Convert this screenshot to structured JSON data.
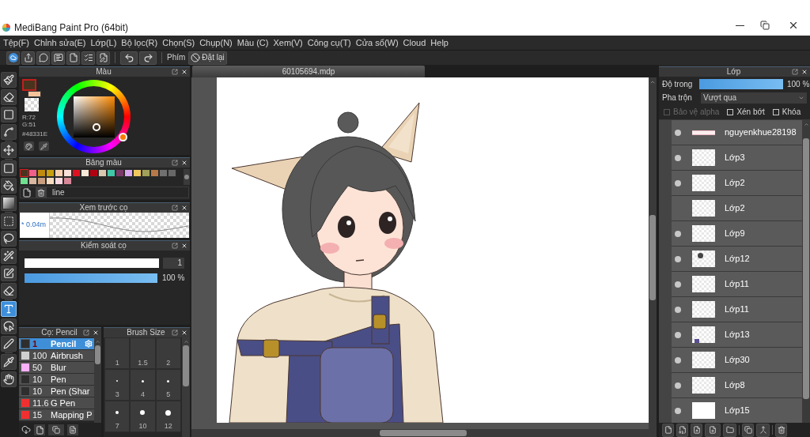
{
  "window": {
    "title": "MediBang Paint Pro (64bit)"
  },
  "menu": [
    "Tệp(F)",
    "Chỉnh sửa(E)",
    "Lớp(L)",
    "Bộ lọc(R)",
    "Chọn(S)",
    "Chụp(N)",
    "Màu (C)",
    "Xem(V)",
    "Công cụ(T)",
    "Cửa sổ(W)",
    "Cloud",
    "Help"
  ],
  "toolbar": {
    "shortcut_label": "Phím",
    "reset_button": "Đặt lại"
  },
  "tools": [
    [
      {
        "kind": "brush",
        "selected": false
      },
      {
        "kind": "eraser",
        "selected": false
      },
      {
        "kind": "shape",
        "selected": false
      },
      {
        "kind": "curve",
        "selected": false
      }
    ],
    [
      {
        "kind": "move",
        "selected": false
      }
    ],
    [
      {
        "kind": "fill",
        "selected": false
      },
      {
        "kind": "bucket",
        "selected": false
      },
      {
        "kind": "gradient",
        "selected": false
      }
    ],
    [
      {
        "kind": "select",
        "selected": false
      },
      {
        "kind": "lasso",
        "selected": false
      },
      {
        "kind": "wand",
        "selected": false
      },
      {
        "kind": "selpen",
        "selected": false
      },
      {
        "kind": "seleraser",
        "selected": false
      }
    ],
    [
      {
        "kind": "text",
        "selected": true
      },
      {
        "kind": "operation",
        "selected": false
      },
      {
        "kind": "pen",
        "selected": false
      }
    ],
    [
      {
        "kind": "dropper",
        "selected": false
      },
      {
        "kind": "hand",
        "selected": false
      }
    ]
  ],
  "color_panel": {
    "title": "Màu",
    "current_colors": [
      {
        "color": "#48331e",
        "selected": true
      },
      {
        "color": "#f7c39a",
        "selected": false
      }
    ],
    "readouts": [
      "R:72",
      "G:51",
      "#48331E"
    ]
  },
  "palette_panel": {
    "title": "Bảng màu",
    "swatches": [
      {
        "color": "#4a3320",
        "selected": true
      },
      {
        "color": "#f0608a",
        "selected": false
      },
      {
        "color": "#c08c10",
        "selected": false
      },
      {
        "color": "#c8a010",
        "selected": false
      },
      {
        "color": "#f8d0b0",
        "selected": false
      },
      {
        "color": "#f8e0d8",
        "selected": false
      },
      {
        "color": "#e01020",
        "selected": false
      },
      {
        "color": "#fae8d8",
        "selected": false
      },
      {
        "color": "#b00010",
        "selected": false
      },
      {
        "color": "#d8c8b0",
        "selected": false
      },
      {
        "color": "#40c8a8",
        "selected": false
      },
      {
        "color": "#7a3a68",
        "selected": false
      },
      {
        "color": "#d8a8f0",
        "selected": false
      },
      {
        "color": "#f0c860",
        "selected": false
      },
      {
        "color": "#a0a058",
        "selected": false
      },
      {
        "color": "#b87848",
        "selected": false
      },
      {
        "color": "#707070",
        "selected": false
      },
      {
        "color": "#686868",
        "selected": false
      },
      {
        "color": "#70e090",
        "selected": false
      },
      {
        "color": "#d8b8a0",
        "selected": false
      },
      {
        "color": "#c8a080",
        "selected": false
      },
      {
        "color": "#f5dcc0",
        "selected": false
      },
      {
        "color": "#f8d8e0",
        "selected": false
      },
      {
        "color": "#d88898",
        "selected": false
      }
    ],
    "palette_name": "line"
  },
  "brush_preview": {
    "title": "Xem trước cọ",
    "size_text": "* 0.04m"
  },
  "brush_control": {
    "title": "Kiểm soát cọ",
    "size": {
      "level": 0,
      "value": "1"
    },
    "opacity": {
      "level": 1,
      "reading": "100 %"
    }
  },
  "brush_list": {
    "title": "Cọ: Pencil",
    "items": [
      {
        "size": "1",
        "name": "Pencil",
        "color": "#2e2e2e",
        "selected": true
      },
      {
        "size": "100",
        "name": "Airbrush",
        "color": "#d0d0d0",
        "selected": false
      },
      {
        "size": "50",
        "name": "Blur",
        "color": "#f8b0f8",
        "selected": false
      },
      {
        "size": "10",
        "name": "Pen",
        "color": "#2e2e2e",
        "selected": false
      },
      {
        "size": "10",
        "name": "Pen (Shar",
        "color": "#2e2e2e",
        "selected": false
      },
      {
        "size": "11.6",
        "name": "G Pen",
        "color": "#f03030",
        "selected": false
      },
      {
        "size": "15",
        "name": "Mapping P",
        "color": "#f03030",
        "selected": false
      }
    ]
  },
  "brush_size": {
    "title": "Brush Size",
    "sizes": [
      "1",
      "1.5",
      "2",
      "3",
      "4",
      "5",
      "7",
      "10",
      "12"
    ]
  },
  "document_tab": {
    "title": "60105694.mdp"
  },
  "layers_panel": {
    "title": "Lớp",
    "opacity": {
      "label": "Độ trong",
      "level": 1,
      "reading": "100 %"
    },
    "blend": {
      "label": "Pha trộn",
      "value": "Vượt qua"
    },
    "options": [
      {
        "label": "Bảo vệ alpha",
        "checked": false,
        "disabled": true
      },
      {
        "label": "Xén bớt",
        "checked": false,
        "disabled": false
      },
      {
        "label": "Khóa",
        "checked": false,
        "disabled": false
      }
    ],
    "layers": [
      {
        "name": "nguyenkhue28198",
        "visible": true,
        "kind": "stroke"
      },
      {
        "name": "Lớp3",
        "visible": true,
        "kind": "transparent"
      },
      {
        "name": "Lớp2",
        "visible": true,
        "kind": "transparent"
      },
      {
        "name": "Lớp2",
        "visible": false,
        "kind": "transparent"
      },
      {
        "name": "Lớp9",
        "visible": true,
        "kind": "transparent"
      },
      {
        "name": "Lớp12",
        "visible": true,
        "kind": "hair"
      },
      {
        "name": "Lớp11",
        "visible": true,
        "kind": "transparent"
      },
      {
        "name": "Lớp11",
        "visible": true,
        "kind": "transparent"
      },
      {
        "name": "Lớp13",
        "visible": true,
        "kind": "overalls"
      },
      {
        "name": "Lớp30",
        "visible": true,
        "kind": "transparent"
      },
      {
        "name": "Lớp8",
        "visible": true,
        "kind": "transparent"
      },
      {
        "name": "Lớp15",
        "visible": true,
        "kind": "white"
      }
    ]
  }
}
